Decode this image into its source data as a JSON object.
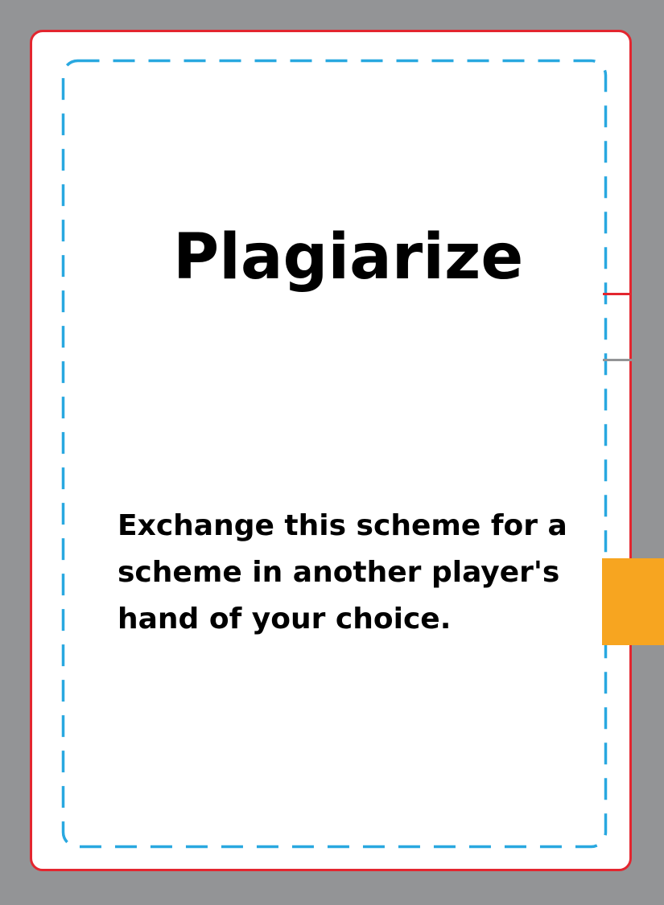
{
  "card": {
    "title": "Plagiarize",
    "description": "Exchange this scheme for a scheme in another player's hand of your choice."
  },
  "colors": {
    "background": "#939496",
    "card_fill": "#ffffff",
    "cut_line": "#e3262f",
    "safe_zone": "#29a8e0",
    "tab": "#f7a520",
    "text": "#000000"
  }
}
